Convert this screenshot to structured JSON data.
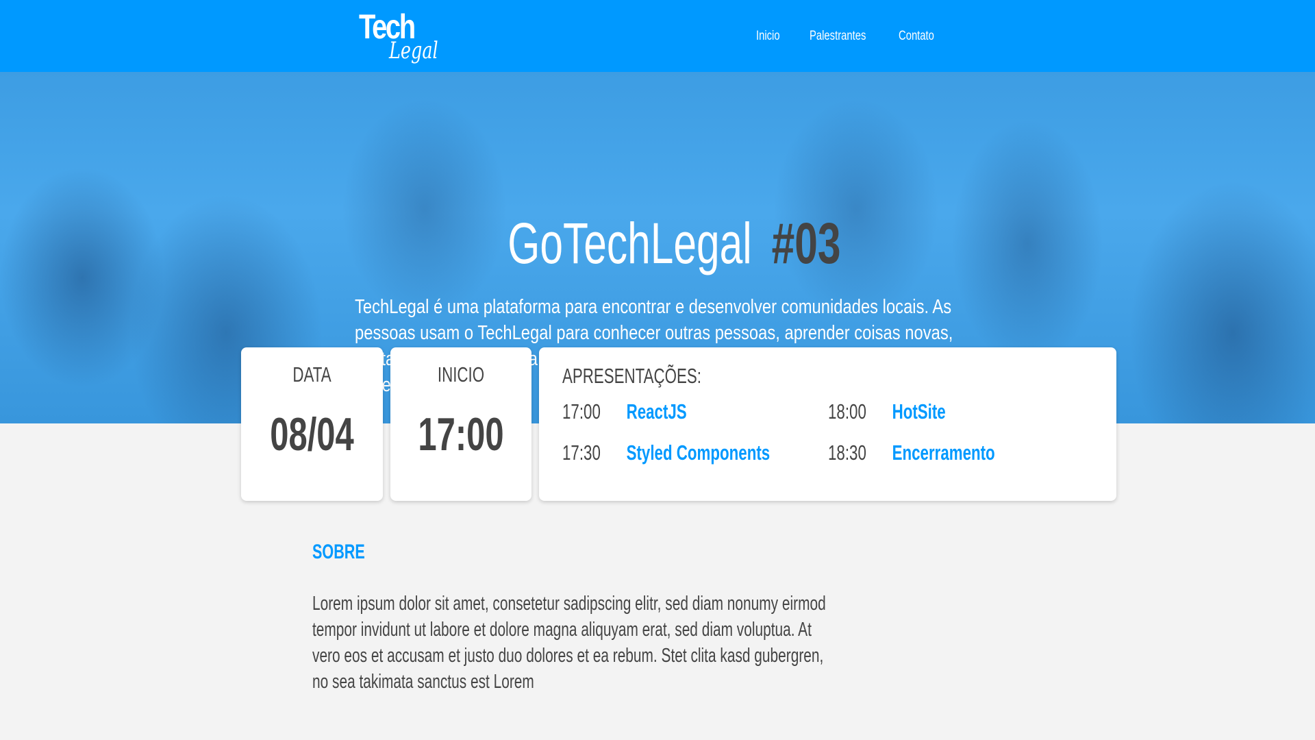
{
  "header": {
    "logo_top": "Tech",
    "logo_bottom": "Legal",
    "nav": [
      "Inicio",
      "Palestrantes",
      "Contato"
    ]
  },
  "hero": {
    "title": "GoTechLegal",
    "number": "#03",
    "description": "TechLegal é uma plataforma para encontrar e desenvolver comunidades locais. As pessoas usam o TechLegal para conhecer outras pessoas, aprender coisas novas, contar com apoio, sair da sua zona de conforto e, juntas, fazerem mais daquilo que curtem."
  },
  "cards": {
    "date_label": "DATA",
    "date_value": "08/04",
    "start_label": "INICIO",
    "start_value": "17:00",
    "talks_label": "APRESENTAÇÕES:",
    "talks": [
      {
        "time": "17:00",
        "title": "ReactJS"
      },
      {
        "time": "18:00",
        "title": "HotSite"
      },
      {
        "time": "17:30",
        "title": "Styled Components"
      },
      {
        "time": "18:30",
        "title": "Encerramento"
      }
    ]
  },
  "about": {
    "heading": "SOBRE",
    "text": "Lorem ipsum dolor sit amet, consetetur sadipscing elitr, sed diam nonumy eirmod tempor invidunt ut labore et dolore magna aliquyam erat, sed diam voluptua. At vero eos et accusam et justo duo dolores et ea rebum. Stet clita kasd gubergren, no sea takimata sanctus est Lorem"
  }
}
